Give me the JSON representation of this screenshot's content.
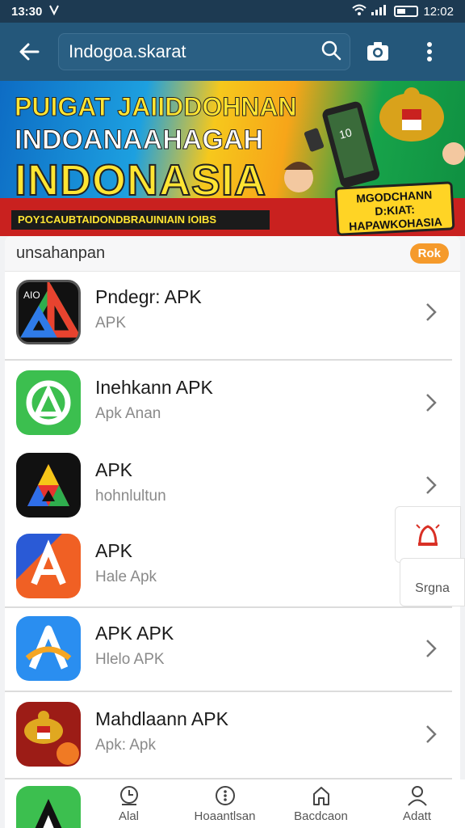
{
  "status_bar": {
    "time": "13:30",
    "battery_time": "12:02"
  },
  "search": {
    "value": "Indogoa.skarat"
  },
  "banner": {
    "line1": "PUIGAT JAIIDDOHNAN",
    "line2": "INDOANAAHAGAH",
    "line3": "INDONASIA",
    "tagline": "POY1CAUBTAIDONDBRAUINIAIN IOIBS",
    "sticker": "MGODCHANN D:KIAT: HAPAWKOHASIA"
  },
  "list": {
    "header_title": "unsahanpan",
    "header_badge": "Rok",
    "items": [
      {
        "name": "Pndegr: APK",
        "sub": "APK",
        "icon": "triangle-app-icon"
      },
      {
        "name": "Inehkann APK",
        "sub": "Apk  Anan",
        "icon": "green-a-app-icon"
      },
      {
        "name": "APK",
        "sub": "hohnlultun",
        "icon": "color-a-app-icon"
      },
      {
        "name": "APK",
        "sub": "Hale Apk",
        "icon": "orange-a-app-icon"
      },
      {
        "name": "APK APK",
        "sub": "Hlelo APK",
        "icon": "blue-a-app-icon"
      },
      {
        "name": "Mahdlaann APK",
        "sub": "Apk: Apk",
        "icon": "garuda-app-icon"
      }
    ]
  },
  "share_label": "Srgna",
  "bottom_nav": [
    {
      "label": "Alal",
      "icon": "home-icon"
    },
    {
      "label": "Hoaantlsan",
      "icon": "info-icon"
    },
    {
      "label": "Bacdcaon",
      "icon": "house-icon"
    },
    {
      "label": "Adatt",
      "icon": "user-icon"
    }
  ],
  "colors": {
    "appbar": "#24577a",
    "statusbar": "#1d3a52",
    "badge": "#f59a2b"
  }
}
